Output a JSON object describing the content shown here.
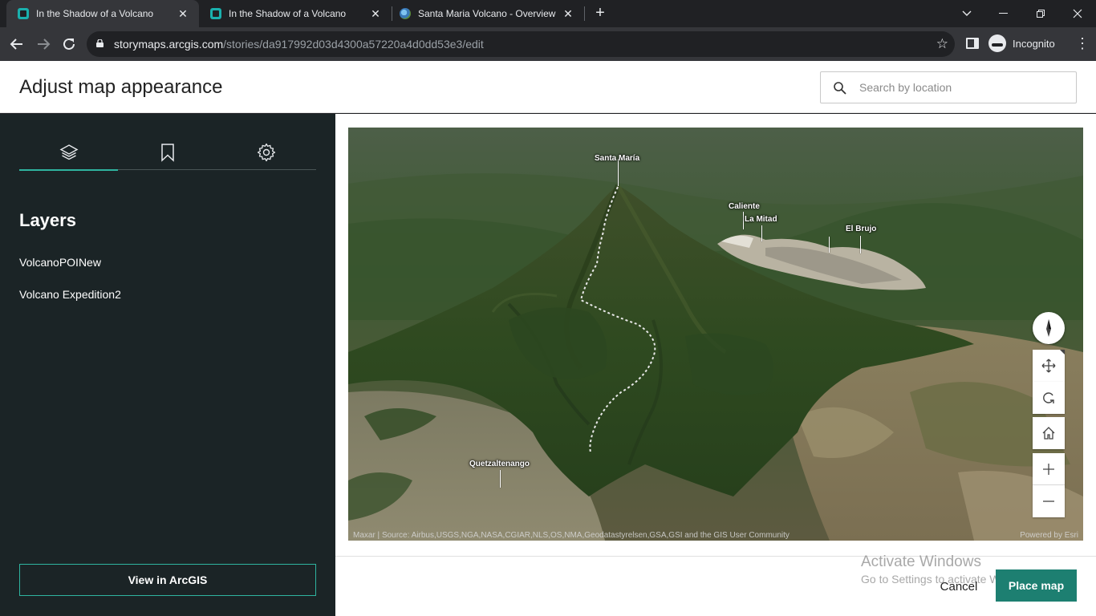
{
  "browser": {
    "tabs": [
      {
        "title": "In the Shadow of a Volcano",
        "favicon": "storymaps-icon",
        "active": true
      },
      {
        "title": "In the Shadow of a Volcano",
        "favicon": "storymaps-icon",
        "active": false
      },
      {
        "title": "Santa Maria Volcano - Overview",
        "favicon": "globe-icon",
        "active": false
      }
    ],
    "url_host": "storymaps.arcgis.com",
    "url_path": "/stories/da917992d03d4300a57220a4d0dd53e3/edit",
    "profile_label": "Incognito"
  },
  "header": {
    "title": "Adjust map appearance",
    "search_placeholder": "Search by location"
  },
  "left_panel": {
    "tabs": [
      {
        "icon": "layers-icon",
        "active": true
      },
      {
        "icon": "bookmark-icon",
        "active": false
      },
      {
        "icon": "gear-icon",
        "active": false
      }
    ],
    "section_title": "Layers",
    "layers": [
      "VolcanoPOINew",
      "Volcano Expedition2"
    ],
    "view_button": "View in ArcGIS"
  },
  "map": {
    "labels": {
      "santa_maria": "Santa María",
      "caliente": "Caliente",
      "la_mitad": "La Mitad",
      "el_brujo": "El Brujo",
      "quetzaltenango": "Quetzaltenango"
    },
    "attribution": "Maxar | Source: Airbus,USGS,NGA,NASA,CGIAR,NLS,OS,NMA,Geodatastyrelsen,GSA,GSI and the GIS User Community",
    "powered_by": "Powered by Esri",
    "controls": [
      "compass-icon",
      "pan-icon",
      "rotate-icon",
      "home-icon",
      "zoom-in-icon",
      "zoom-out-icon"
    ]
  },
  "footer": {
    "cancel_label": "Cancel",
    "place_label": "Place map"
  },
  "watermark": {
    "line1": "Activate Windows",
    "line2": "Go to Settings to activate Windows."
  },
  "colors": {
    "accent": "#2fb4a0",
    "primary_button": "#1d7f71",
    "panel_bg": "#1b2426"
  }
}
